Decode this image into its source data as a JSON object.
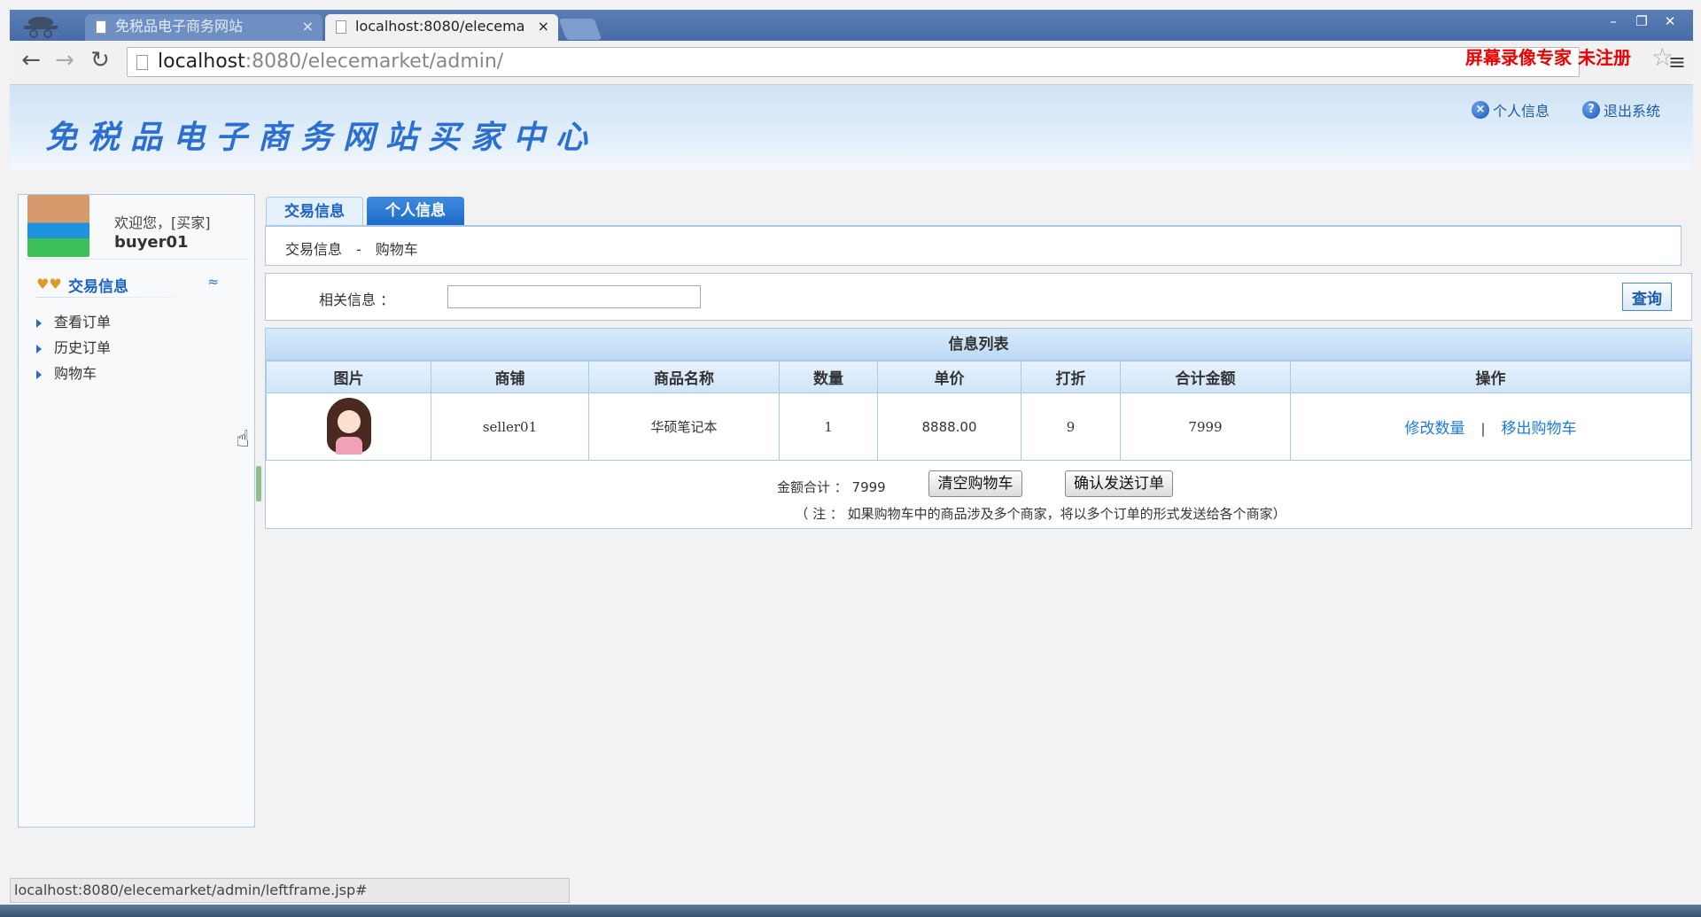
{
  "browser": {
    "tabs": [
      {
        "title": "免税品电子商务网站",
        "close": "×"
      },
      {
        "title": "localhost:8080/elecema",
        "close": "×"
      }
    ],
    "window_controls": [
      "–",
      "❐",
      "✕"
    ],
    "nav": {
      "back": "←",
      "forward": "→",
      "reload": "↻"
    },
    "url_host": "localhost",
    "url_rest": ":8080/elecemarket/admin/",
    "star": "☆",
    "menu": "≡",
    "watermark": "屏幕录像专家 未注册"
  },
  "header": {
    "site_title": "免税品电子商务网站买家中心",
    "profile_link": "个人信息",
    "logout_link": "退出系统",
    "profile_icon": "x-circle-icon",
    "logout_icon": "help-circle-icon"
  },
  "sidebar": {
    "welcome": "欢迎您，[买家]",
    "username": "buyer01",
    "section_title": "交易信息",
    "section_toggle": "≈",
    "items": [
      {
        "label": "查看订单"
      },
      {
        "label": "历史订单"
      },
      {
        "label": "购物车"
      }
    ]
  },
  "main": {
    "tabs": [
      {
        "label": "交易信息"
      },
      {
        "label": "个人信息"
      }
    ],
    "breadcrumb": {
      "root": "交易信息",
      "sep": "-",
      "current": "购物车"
    },
    "search": {
      "label": "相关信息 ：",
      "value": "",
      "button": "查询"
    },
    "list": {
      "title": "信息列表",
      "columns": [
        "图片",
        "商铺",
        "商品名称",
        "数量",
        "单价",
        "打折",
        "合计金额",
        "操作"
      ],
      "rows": [
        {
          "shop": "seller01",
          "name": "华硕笔记本",
          "qty": "1",
          "price": "8888.00",
          "discount": "9",
          "total": "7999",
          "op_edit": "修改数量",
          "op_sep": "|",
          "op_remove": "移出购物车"
        }
      ]
    },
    "summary": {
      "total_label": "金额合计 ： 7999",
      "clear_button": "清空购物车",
      "confirm_button": "确认发送订单",
      "note": "（ 注 ： 如果购物车中的商品涉及多个商家，将以多个订单的形式发送给各个商家）"
    }
  },
  "status_bar": "localhost:8080/elecemarket/admin/leftframe.jsp#",
  "colors": {
    "accent": "#1d64c2",
    "border": "#a9c8ea",
    "link": "#1d7bd8"
  }
}
